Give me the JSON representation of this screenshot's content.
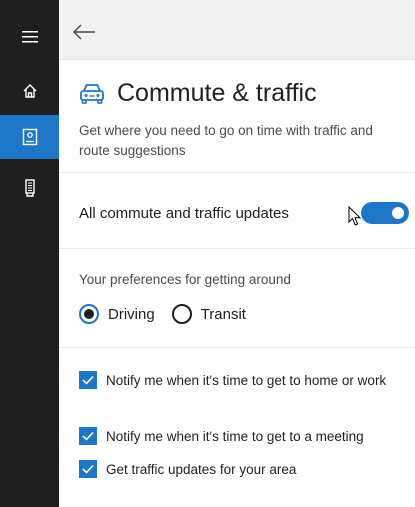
{
  "colors": {
    "accent": "#1e76c9",
    "rail_bg": "#1f1f1f",
    "topbar_bg": "#f2f2f2"
  },
  "rail": {
    "items": [
      {
        "icon": "hamburger-menu-icon",
        "active": false
      },
      {
        "icon": "home-icon",
        "active": false
      },
      {
        "icon": "notebook-icon",
        "active": true
      },
      {
        "icon": "feedback-icon",
        "active": false
      }
    ]
  },
  "topbar": {
    "back_icon": "back-arrow-icon"
  },
  "page": {
    "icon": "car-icon",
    "title": "Commute & traffic",
    "description": "Get where you need to go on time with traffic and route suggestions"
  },
  "toggle": {
    "label": "All commute and traffic updates",
    "state": "on"
  },
  "preferences": {
    "heading": "Your preferences for getting around",
    "options": [
      {
        "label": "Driving",
        "selected": true
      },
      {
        "label": "Transit",
        "selected": false
      }
    ]
  },
  "notifications": [
    {
      "label": "Notify me when it's time to get to home or work",
      "checked": true
    },
    {
      "label": "Notify me when it's time to get to a meeting",
      "checked": true
    },
    {
      "label": "Get traffic updates for your area",
      "checked": true
    }
  ]
}
